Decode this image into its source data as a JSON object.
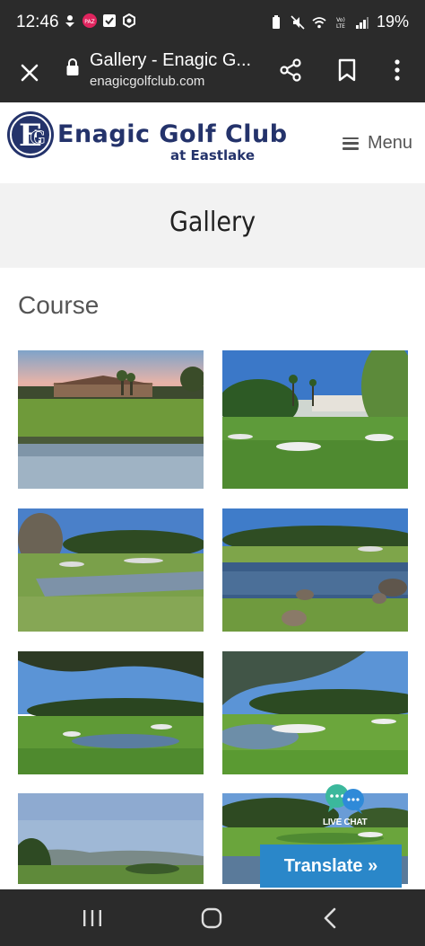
{
  "status_bar": {
    "time": "12:46",
    "battery": "19%",
    "icons": [
      "sailing-icon",
      "app-badge-icon",
      "check-box-icon",
      "hex-icon",
      "battery-saver-icon",
      "mute-icon",
      "wifi-icon",
      "volte-icon",
      "signal-icon"
    ]
  },
  "browser": {
    "page_title": "Gallery - Enagic G...",
    "url": "enagicgolfclub.com"
  },
  "site": {
    "logo_text": "Enagic Golf Club",
    "logo_subtext": "at Eastlake",
    "menu_label": "Menu",
    "brand_color": "#24336b"
  },
  "page": {
    "title": "Gallery",
    "section": "Course"
  },
  "gallery": {
    "items": [
      {
        "name": "clubhouse-pond-photo"
      },
      {
        "name": "bunkers-palms-photo"
      },
      {
        "name": "fairway-pond-photo"
      },
      {
        "name": "lake-rocks-photo"
      },
      {
        "name": "pine-fairway-photo"
      },
      {
        "name": "green-bunker-photo"
      },
      {
        "name": "hillside-view-photo"
      },
      {
        "name": "green-pond-photo"
      }
    ]
  },
  "widgets": {
    "live_chat_label": "LIVE CHAT",
    "translate_label": "Translate »",
    "translate_color": "#2a87c9"
  }
}
